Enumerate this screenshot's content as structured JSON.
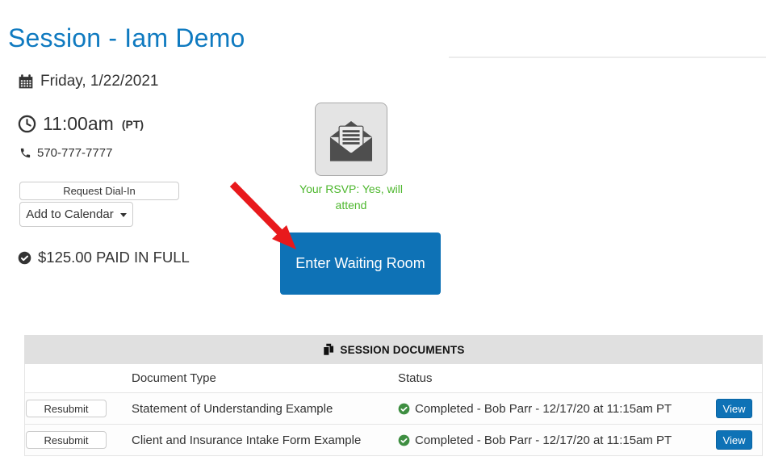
{
  "page": {
    "title": "Session - Iam Demo"
  },
  "session": {
    "date": "Friday, 1/22/2021",
    "time": "11:00am",
    "timezone": "(PT)",
    "phone": "570-777-7777",
    "request_dial_in_label": "Request Dial-In",
    "add_to_calendar_label": "Add to Calendar",
    "payment_status": "$125.00 PAID IN FULL",
    "rsvp_status": "Your RSVP: Yes, will attend",
    "enter_waiting_room_label": "Enter Waiting Room"
  },
  "documents_table": {
    "title": "SESSION DOCUMENTS",
    "columns": {
      "document_type": "Document Type",
      "status": "Status"
    },
    "resubmit_label": "Resubmit",
    "view_label": "View",
    "rows": [
      {
        "document_type": "Statement of Understanding Example",
        "status": "Completed - Bob Parr - 12/17/20 at 11:15am PT"
      },
      {
        "document_type": "Client and Insurance Intake Form Example",
        "status": "Completed - Bob Parr - 12/17/20 at 11:15am PT"
      }
    ]
  },
  "icons": {
    "calendar": "calendar-icon",
    "clock": "clock-icon",
    "phone": "phone-icon",
    "paid_check": "check-circle-icon",
    "rsvp_envelope": "open-envelope-icon",
    "documents": "documents-icon",
    "status_check": "check-circle-green-icon",
    "caret": "caret-down-icon",
    "arrow": "red-arrow-annotation"
  },
  "colors": {
    "title_blue": "#0f7ac0",
    "primary_blue": "#0e72b6",
    "rsvp_green": "#4db72d",
    "status_green": "#3e8e41",
    "arrow_red": "#e8191c",
    "header_gray": "#e0e0e0"
  }
}
